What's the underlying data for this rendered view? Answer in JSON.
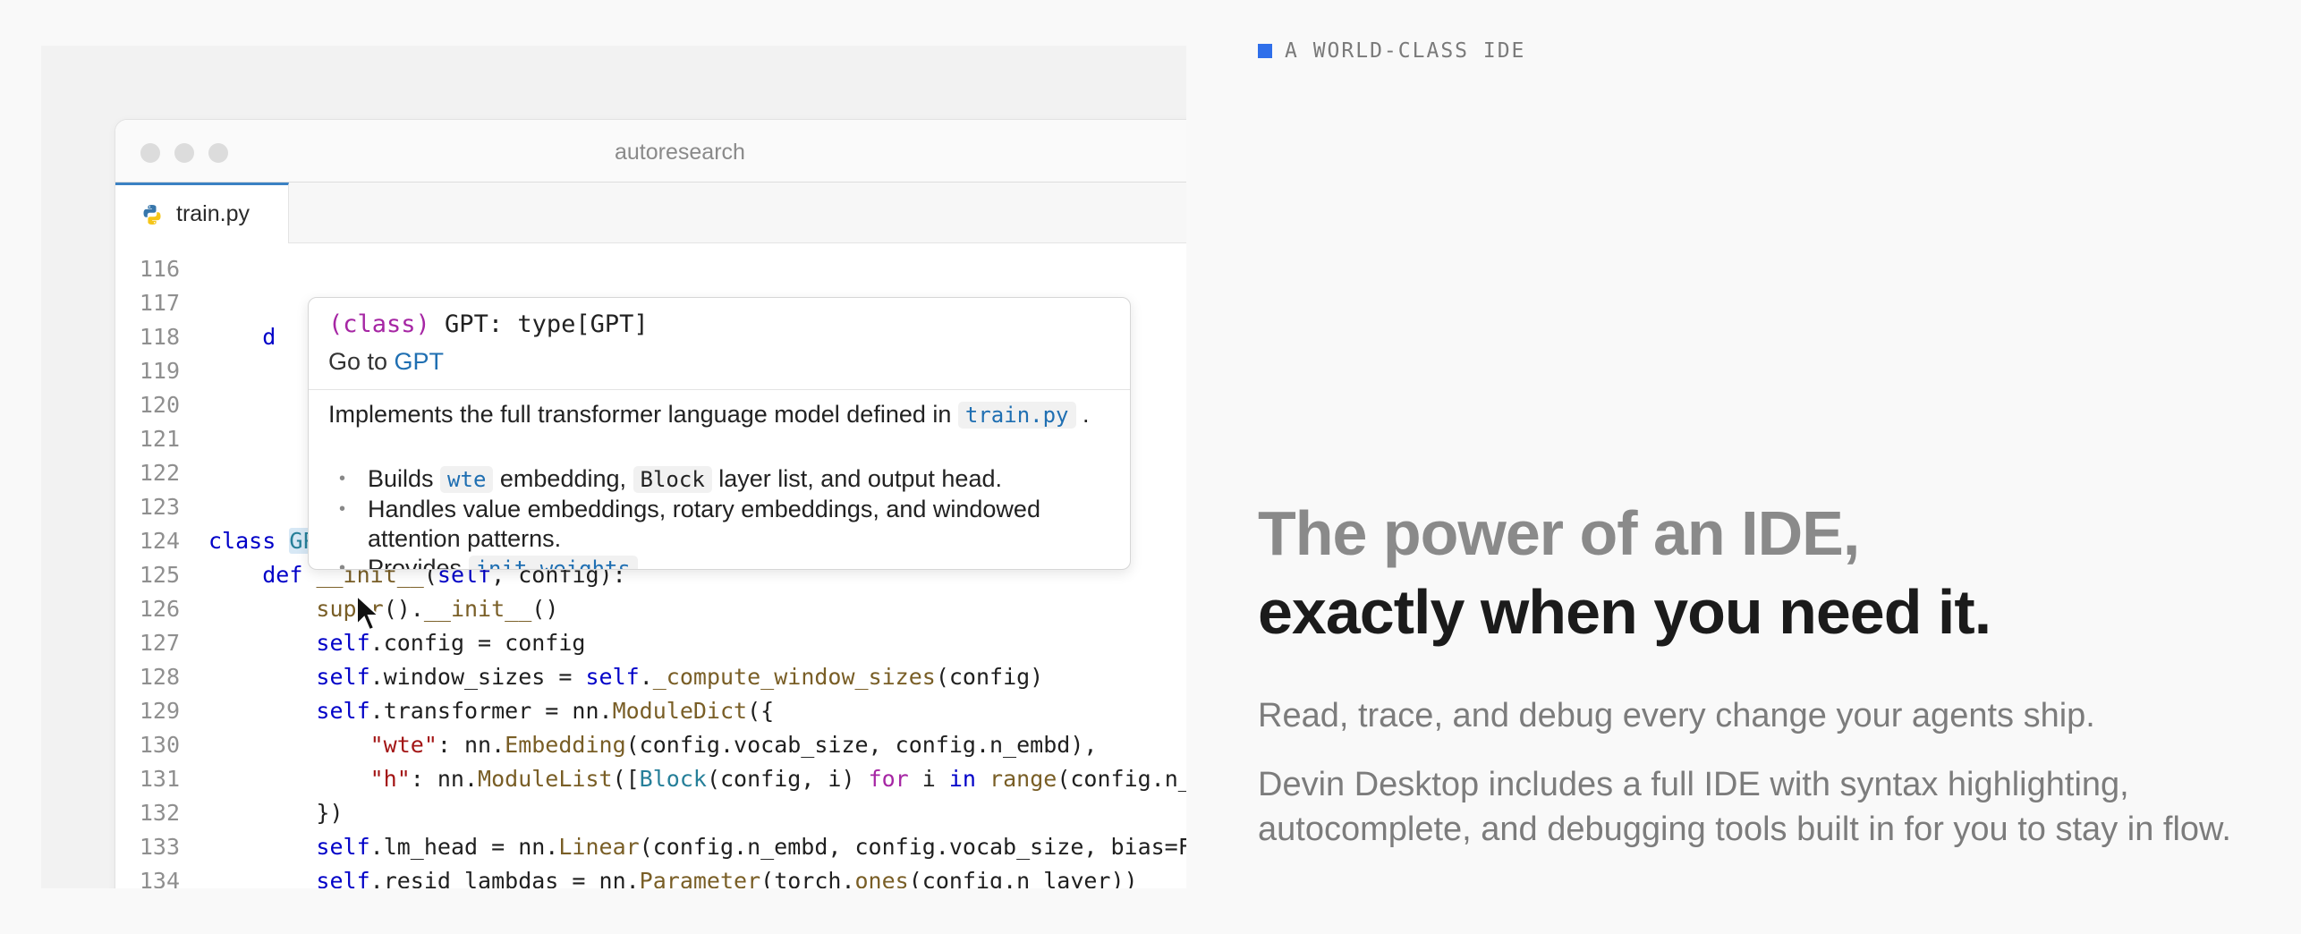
{
  "window": {
    "title": "autoresearch"
  },
  "tab": {
    "label": "train.py",
    "icon": "python-icon"
  },
  "code_lines": [
    {
      "n": "116",
      "html": ""
    },
    {
      "n": "117",
      "html": ""
    },
    {
      "n": "118",
      "html": "    <span class=\"kw\">d</span>"
    },
    {
      "n": "119",
      "html": ""
    },
    {
      "n": "120",
      "html": ""
    },
    {
      "n": "121",
      "html": ""
    },
    {
      "n": "122",
      "html": ""
    },
    {
      "n": "123",
      "html": ""
    },
    {
      "n": "124",
      "html": "<span class=\"kw\">class</span> <span class=\"hl\">GPT</span>(nn.Module):"
    },
    {
      "n": "125",
      "html": "    <span class=\"kw\">def</span> <span class=\"fn\">__init__</span>(<span class=\"self\">self</span>, config):"
    },
    {
      "n": "126",
      "html": "        <span class=\"fn\">super</span>().<span class=\"fn\">__init__</span>()"
    },
    {
      "n": "127",
      "html": "        <span class=\"self\">self</span>.config = config"
    },
    {
      "n": "128",
      "html": "        <span class=\"self\">self</span>.window_sizes = <span class=\"self\">self</span>.<span class=\"fn\">_compute_window_sizes</span>(config)"
    },
    {
      "n": "129",
      "html": "        <span class=\"self\">self</span>.transformer = nn.<span class=\"fn\">ModuleDict</span>({"
    },
    {
      "n": "130",
      "html": "            <span class=\"str\">\"wte\"</span>: nn.<span class=\"fn\">Embedding</span>(config.vocab_size, config.n_embd),"
    },
    {
      "n": "131",
      "html": "            <span class=\"str\">\"h\"</span>: nn.<span class=\"fn\">ModuleList</span>([<span class=\"cls\">Block</span>(config, i) <span class=\"kw2\">for</span> i <span class=\"kw\">in</span> <span class=\"fn\">range</span>(config.n_layer)])"
    },
    {
      "n": "132",
      "html": "        })"
    },
    {
      "n": "133",
      "html": "        <span class=\"self\">self</span>.lm_head = nn.<span class=\"fn\">Linear</span>(config.n_embd, config.vocab_size, bias=False)"
    },
    {
      "n": "134",
      "html": "        <span class=\"self\">self</span>.resid_lambdas = nn.<span class=\"fn\">Parameter</span>(torch.<span class=\"fn\">ones</span>(config.n_layer))"
    }
  ],
  "hover": {
    "kind": "(class)",
    "signature": " GPT: type[GPT]",
    "goto_prefix": "Go to ",
    "goto_link": "GPT",
    "description": "Implements the full transformer language model defined in",
    "description_file": "train.py",
    "description_end": ".",
    "bullets": [
      {
        "before": "Builds ",
        "code1": "wte",
        "middle": " embedding, ",
        "code2": "Block",
        "after": " layer list, and output head."
      },
      {
        "text": "Handles value embeddings, rotary embeddings, and windowed attention patterns."
      },
      {
        "before": "Provides ",
        "code1": "init_weights",
        "middle": "",
        "code2": "",
        "after": ""
      }
    ]
  },
  "eyebrow": "A WORLD-CLASS IDE",
  "headline": {
    "line1": "The power of an IDE,",
    "line2": "exactly when you need it."
  },
  "subhead": "Read, trace, and debug every change your agents ship.",
  "body": "Devin Desktop includes a full IDE with syntax highlighting, autocomplete, and debugging tools built in for you to stay in flow.",
  "colors": {
    "accent": "#2f6fea",
    "tab_border": "#3b82c4",
    "link": "#1f6fb2"
  }
}
